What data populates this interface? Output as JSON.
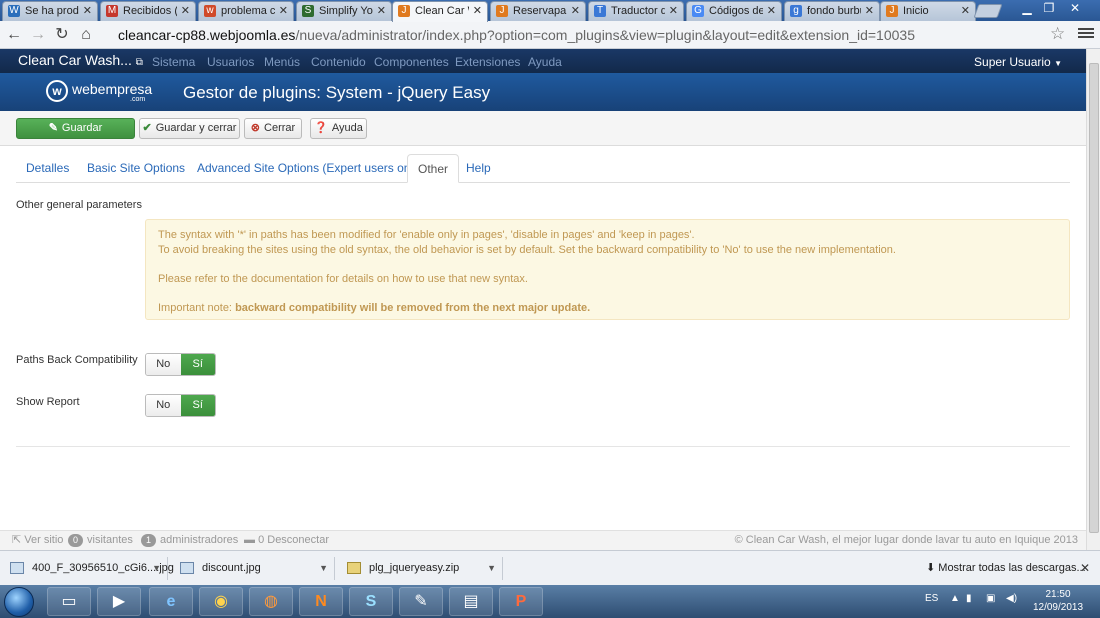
{
  "browser": {
    "tabs": [
      {
        "title": "Se ha produ",
        "favicon": "W",
        "color": "#2a6ebb"
      },
      {
        "title": "Recibidos (",
        "favicon": "M",
        "color": "#c5372c"
      },
      {
        "title": "problema co",
        "favicon": "w",
        "color": "#d04a2a"
      },
      {
        "title": "Simplify You",
        "favicon": "S",
        "color": "#2f6b2f"
      },
      {
        "title": "Clean Car W",
        "favicon": "J",
        "color": "#e07a1f"
      },
      {
        "title": "Reservapart",
        "favicon": "J",
        "color": "#e07a1f"
      },
      {
        "title": "Traductor de",
        "favicon": "T",
        "color": "#3a78d6"
      },
      {
        "title": "Códigos de",
        "favicon": "G",
        "color": "#4a8af4"
      },
      {
        "title": "fondo burbu",
        "favicon": "g",
        "color": "#3a78d6"
      },
      {
        "title": "Inicio",
        "favicon": "J",
        "color": "#e07a1f"
      }
    ],
    "url_host": "cleancar-cp88.webjoomla.es",
    "url_path": "/nueva/administrator/index.php?option=com_plugins&view=plugin&layout=edit&extension_id=10035"
  },
  "jnav": {
    "brand": "Clean Car Wash...",
    "menu": [
      "Sistema",
      "Usuarios",
      "Menús",
      "Contenido",
      "Componentes",
      "Extensiones",
      "Ayuda"
    ],
    "user": "Super Usuario"
  },
  "header": {
    "logo_name": "webempresa",
    "logo_sub": ".com",
    "title": "Gestor de plugins: System - jQuery Easy"
  },
  "toolbar": {
    "save": "Guardar",
    "save_close": "Guardar y cerrar",
    "close": "Cerrar",
    "help": "Ayuda"
  },
  "tabs": [
    "Detalles",
    "Basic Site Options",
    "Advanced Site Options (Expert users only)",
    "Other",
    "Help"
  ],
  "form": {
    "legend": "Other general parameters",
    "alert": {
      "line1": "The syntax with '*' in paths has been modified for 'enable only in pages', 'disable in pages' and 'keep in pages'.",
      "line2": "To avoid breaking the sites using the old syntax, the old behavior is set by default. Set the backward compatibility to 'No' to use the new implementation.",
      "line3": "Please refer to the documentation for details on how to use that new syntax.",
      "note_prefix": "Important note:",
      "note_bold": "backward compatibility will be removed from the next major update."
    },
    "fields": [
      {
        "label": "Paths Back Compatibility",
        "no": "No",
        "yes": "Sí",
        "selected": "yes"
      },
      {
        "label": "Show Report",
        "no": "No",
        "yes": "Sí",
        "selected": "yes"
      }
    ]
  },
  "status": {
    "view_site": "Ver sitio",
    "visitors_count": "0",
    "visitors": "visitantes",
    "admins_count": "1",
    "admins": "administradores",
    "logout_count": "0",
    "logout": "Desconectar",
    "copyright": "© Clean Car Wash, el mejor lugar donde lavar tu auto en Iquique 2013"
  },
  "downloads": {
    "items": [
      "400_F_30956510_cGi6....jpg",
      "discount.jpg",
      "plg_jqueryeasy.zip"
    ],
    "show_all": "Mostrar todas las descargas..."
  },
  "taskbar": {
    "lang": "ES",
    "time": "21:50",
    "date": "12/09/2013"
  }
}
